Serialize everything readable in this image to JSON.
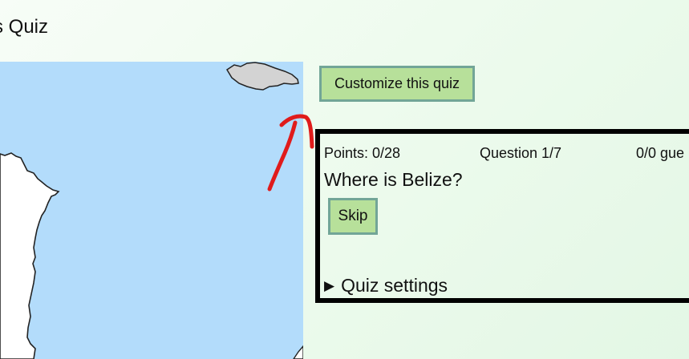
{
  "page": {
    "title": "s Quiz"
  },
  "map": {
    "ocean_color": "#b3dcfb",
    "land_color": "#ffffff",
    "island_color": "#d3d3d3"
  },
  "customize": {
    "label": "Customize this quiz"
  },
  "annotation": {
    "color": "#e01b1b",
    "icon": "red-arrow-icon"
  },
  "quiz": {
    "points": "Points: 0/28",
    "question_counter": "Question 1/7",
    "guesses": "0/0 gue",
    "question": "Where is Belize?",
    "skip_label": "Skip",
    "settings_toggle_icon": "▶",
    "settings_label": "Quiz settings"
  }
}
